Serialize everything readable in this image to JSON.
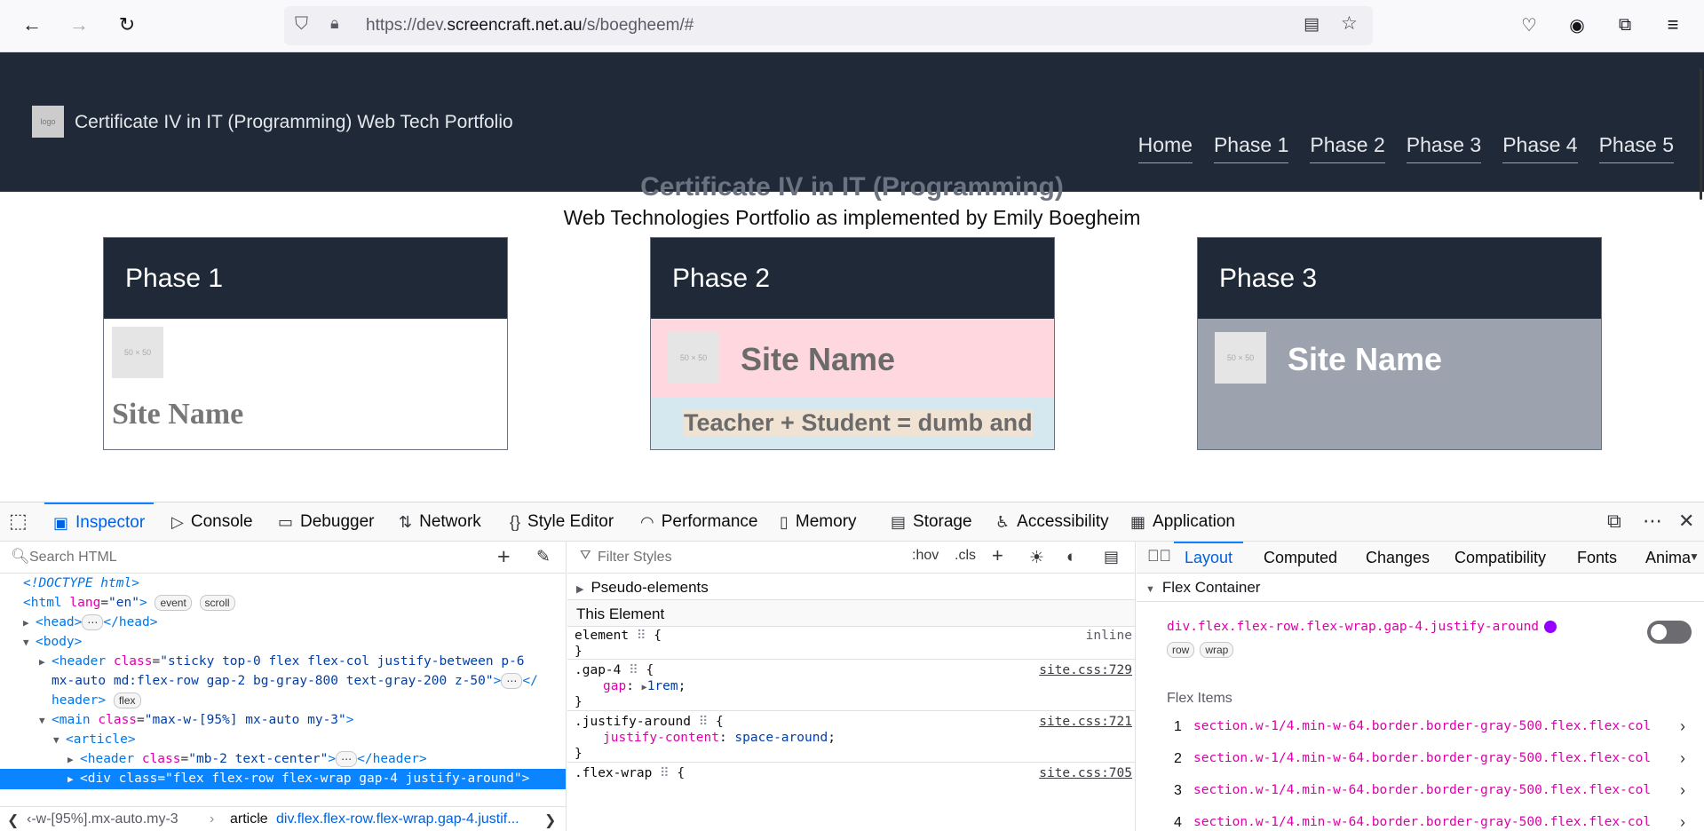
{
  "browser": {
    "url_prefix": "https://dev.",
    "url_domain": "screencraft.net.au",
    "url_path": "/s/boegheem/#"
  },
  "site": {
    "logo_text": "logo",
    "title": "Certificate IV in IT (Programming) Web Tech Portfolio",
    "nav": [
      "Home",
      "Phase 1",
      "Phase 2",
      "Phase 3",
      "Phase 4",
      "Phase 5"
    ],
    "heading": "Certificate IV in IT (Programming)",
    "subheading": "Web Technologies Portfolio as implemented by Emily Boegheim",
    "cards": [
      {
        "title": "Phase 1",
        "thumb": "50 × 50",
        "site_name": "Site Name"
      },
      {
        "title": "Phase 2",
        "thumb": "50 × 50",
        "site_name": "Site Name",
        "tagline": "Teacher + Student = dumb and"
      },
      {
        "title": "Phase 3",
        "thumb": "50 × 50",
        "site_name": "Site Name"
      }
    ]
  },
  "devtools": {
    "tabs": [
      "Inspector",
      "Console",
      "Debugger",
      "Network",
      "Style Editor",
      "Performance",
      "Memory",
      "Storage",
      "Accessibility",
      "Application"
    ],
    "active_tab": "Inspector",
    "search_placeholder": "Search HTML",
    "tree": {
      "doctype": "<!DOCTYPE html>",
      "html_lang": "en",
      "badge_event": "event",
      "badge_scroll": "scroll",
      "badge_flex": "flex",
      "header_class": "sticky top-0 flex flex-col justify-between p-6",
      "header_class_2": "mx-auto md:flex-row gap-2 bg-gray-800 text-gray-200 z-50",
      "main_class": "max-w-[95%] mx-auto my-3",
      "article_header_class": "mb-2 text-center",
      "div_class": "flex flex-row flex-wrap gap-4 justify-around"
    },
    "breadcrumbs": [
      "‹-w-[95%].mx-auto.my-3",
      "article",
      "div.flex.flex-row.flex-wrap.gap-4.justif..."
    ],
    "rules": {
      "filter_placeholder": "Filter Styles",
      "hov": ":hov",
      "cls": ".cls",
      "pseudo": "Pseudo-elements",
      "this_element": "This Element",
      "inline": "inline",
      "items": [
        {
          "selector": ".gap-4",
          "source": "site.css:729",
          "prop": "gap",
          "value": "1rem"
        },
        {
          "selector": ".justify-around",
          "source": "site.css:721",
          "prop": "justify-content",
          "value": "space-around"
        },
        {
          "selector": ".flex-wrap",
          "source": "site.css:705"
        }
      ]
    },
    "layout": {
      "tabs": [
        "Layout",
        "Computed",
        "Changes",
        "Compatibility",
        "Fonts",
        "Anima"
      ],
      "flex_container": "Flex Container",
      "selector": "div.flex.flex-row.flex-wrap.gap-4.justify-around",
      "badges": [
        "row",
        "wrap"
      ],
      "flex_items_label": "Flex Items",
      "items": [
        "section.w-1/4.min-w-64.border.border-gray-500.flex.flex-col",
        "section.w-1/4.min-w-64.border.border-gray-500.flex.flex-col",
        "section.w-1/4.min-w-64.border.border-gray-500.flex.flex-col",
        "section.w-1/4.min-w-64.border.border-gray-500.flex.flex-col"
      ]
    }
  }
}
